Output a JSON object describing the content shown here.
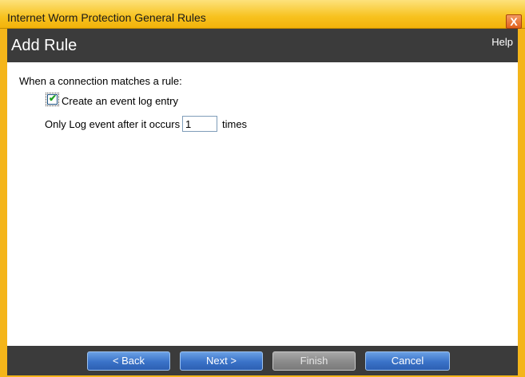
{
  "window": {
    "title": "Internet Worm Protection General Rules",
    "close_symbol": "X"
  },
  "header": {
    "heading": "Add Rule",
    "help_label": "Help"
  },
  "content": {
    "intro_text": "When a connection matches a rule:",
    "log_checkbox": {
      "label": "Create an event log entry",
      "checked": true,
      "check_symbol": "✔"
    },
    "occurs_label": "Only Log event after it occurs",
    "occurs_value": "1",
    "times_label": "times"
  },
  "buttons": {
    "back_label": "< Back",
    "next_label": "Next >",
    "finish_label": "Finish",
    "cancel_label": "Cancel"
  },
  "colors": {
    "frame": "#f4b51a",
    "header_bg": "#3b3b3b",
    "button_blue": "#3a72c8",
    "button_disabled": "#8a8a8a"
  }
}
